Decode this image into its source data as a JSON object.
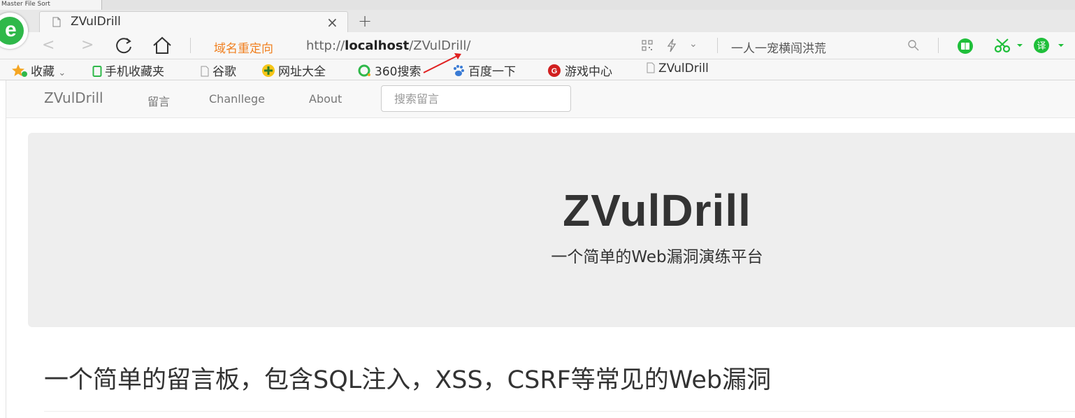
{
  "window": {
    "mini_tab_label": "Master File Sort"
  },
  "tabs": [
    {
      "title": "ZVulDrill",
      "close_glyph": "×"
    }
  ],
  "new_tab_glyph": "+",
  "logo_letter": "e",
  "nav": {
    "back_glyph": "<",
    "forward_glyph": ">"
  },
  "address_bar": {
    "redirect_label": "域名重定向",
    "url_scheme": "http://",
    "url_host": "localhost",
    "url_path": "/ZVulDrill/",
    "chevron_glyph": "⌄"
  },
  "search_bar": {
    "text": "一人一宠横闯洪荒"
  },
  "bookmarks": [
    {
      "label": "收藏",
      "suffix": "⌄",
      "icon": "star-icon"
    },
    {
      "label": "手机收藏夹",
      "icon": "mobile-icon"
    },
    {
      "label": "谷歌",
      "icon": "page-icon"
    },
    {
      "label": "网址大全",
      "icon": "web-directory-icon"
    },
    {
      "label": "360搜索",
      "icon": "360-search-icon"
    },
    {
      "label": "百度一下",
      "icon": "baidu-paw-icon"
    },
    {
      "label": "游戏中心",
      "icon": "game-center-icon"
    },
    {
      "label": "ZVulDrill",
      "icon": "page-icon"
    }
  ],
  "site_nav": {
    "brand": "ZVulDrill",
    "links": [
      "留言",
      "Chanllege",
      "About"
    ],
    "search_placeholder": "搜索留言"
  },
  "jumbotron": {
    "title": "ZVulDrill",
    "subtitle": "一个简单的Web漏洞演练平台"
  },
  "page_header": "一个简单的留言板，包含SQL注入，XSS，CSRF等常见的Web漏洞",
  "colors": {
    "redirect_label": "#f08020",
    "logo_green": "#2fb84a",
    "annotation_arrow": "#e02020",
    "jumbotron_bg": "#eeeeee",
    "navbar_bg": "#f8f8f8"
  }
}
